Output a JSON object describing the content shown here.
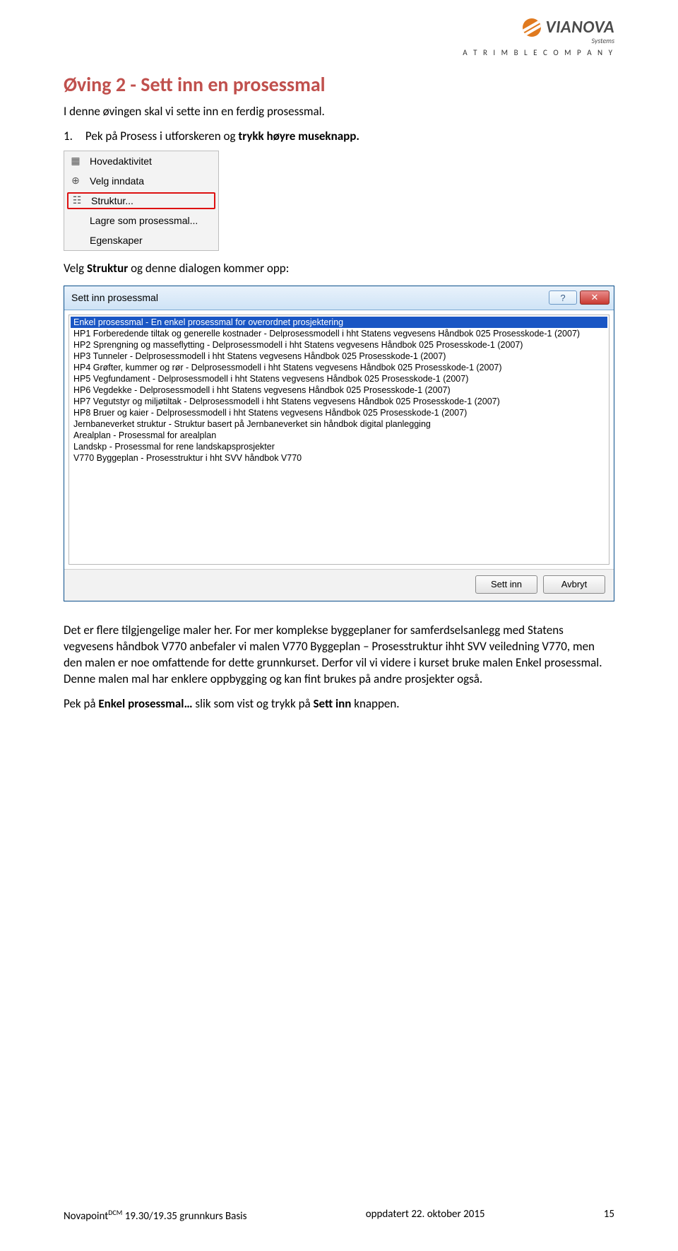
{
  "logo": {
    "brand": "VIANOVA",
    "brand_sub": "Systems",
    "tagline": "A  T R I M B L E  C O M P A N Y"
  },
  "heading": "Øving 2 - Sett inn en prosessmal",
  "intro": "I denne øvingen skal vi sette inn en ferdig prosessmal.",
  "step1_num": "1.",
  "step1_text_a": "Pek på Prosess i utforskeren og ",
  "step1_text_b": "trykk høyre museknapp.",
  "context_menu": {
    "items": [
      {
        "label": "Hovedaktivitet",
        "icon": "▦"
      },
      {
        "label": "Velg inndata",
        "icon": "⊕"
      },
      {
        "label": "Struktur...",
        "icon": "☷",
        "highlight": true
      },
      {
        "label": "Lagre som prosessmal...",
        "icon": ""
      },
      {
        "label": "Egenskaper",
        "icon": ""
      }
    ]
  },
  "after_menu_a": "Velg ",
  "after_menu_b": "Struktur ",
  "after_menu_c": "og denne dialogen kommer opp:",
  "dialog": {
    "title": "Sett inn prosessmal",
    "rows": [
      "Enkel prosessmal - En enkel prosessmal for overordnet prosjektering",
      "HP1 Forberedende tiltak og generelle kostnader - Delprosessmodell i hht Statens vegvesens Håndbok 025 Prosesskode-1 (2007)",
      "HP2 Sprengning og masseflytting - Delprosessmodell i hht Statens vegvesens Håndbok 025 Prosesskode-1 (2007)",
      "HP3 Tunneler - Delprosessmodell i hht Statens vegvesens Håndbok 025 Prosesskode-1 (2007)",
      "HP4 Grøfter, kummer og rør - Delprosessmodell i hht Statens vegvesens Håndbok 025 Prosesskode-1 (2007)",
      "HP5 Vegfundament - Delprosessmodell i hht Statens vegvesens Håndbok 025 Prosesskode-1 (2007)",
      "HP6 Vegdekke - Delprosessmodell i hht Statens vegvesens Håndbok 025 Prosesskode-1 (2007)",
      "HP7 Vegutstyr og miljøtiltak - Delprosessmodell i hht Statens vegvesens Håndbok 025 Prosesskode-1 (2007)",
      "HP8 Bruer og kaier - Delprosessmodell i hht Statens vegvesens Håndbok 025 Prosesskode-1 (2007)",
      "Jernbaneverket struktur - Struktur basert på Jernbaneverket sin håndbok digital planlegging",
      "Arealplan - Prosessmal for arealplan",
      "Landskp - Prosessmal for rene landskapsprosjekter",
      "V770 Byggeplan - Prosesstruktur i hht SVV håndbok V770"
    ],
    "selected_index": 0,
    "insert_btn": "Sett inn",
    "cancel_btn": "Avbryt"
  },
  "para2": "Det er flere tilgjengelige maler her. For mer komplekse byggeplaner for samferdselsanlegg med Statens vegvesens håndbok V770 anbefaler vi malen V770 Byggeplan – Prosesstruktur ihht SVV veiledning V770, men den malen er noe omfattende for dette grunnkurset. Derfor vil vi videre i kurset bruke malen Enkel prosessmal. Denne malen mal har enklere oppbygging og kan fint brukes på andre  prosjekter også.",
  "para3_a": "Pek på ",
  "para3_b": "Enkel prosessmal…",
  "para3_c": " slik som vist og trykk på ",
  "para3_d": "Sett inn",
  "para3_e": " knappen.",
  "footer": {
    "left_a": "Novapoint",
    "left_sup": "DCM",
    "left_b": " 19.30/19.35 grunnkurs Basis",
    "center": "oppdatert 22. oktober 2015",
    "right": "15"
  }
}
